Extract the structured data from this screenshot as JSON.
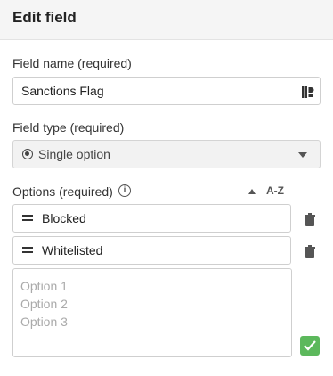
{
  "panel": {
    "title": "Edit field"
  },
  "field_name": {
    "label": "Field name (required)",
    "value": "Sanctions Flag",
    "icon": "keyboard-assist-icon"
  },
  "field_type": {
    "label": "Field type (required)",
    "selected": "Single option",
    "icon": "radio-icon"
  },
  "options": {
    "label": "Options (required)",
    "info_icon": "i",
    "sort_label": "A-Z",
    "items": [
      {
        "label": "Blocked"
      },
      {
        "label": "Whitelisted"
      }
    ],
    "new_placeholder_lines": [
      "Option 1",
      "Option 2",
      "Option 3"
    ],
    "confirm_color": "#5cb85c"
  }
}
